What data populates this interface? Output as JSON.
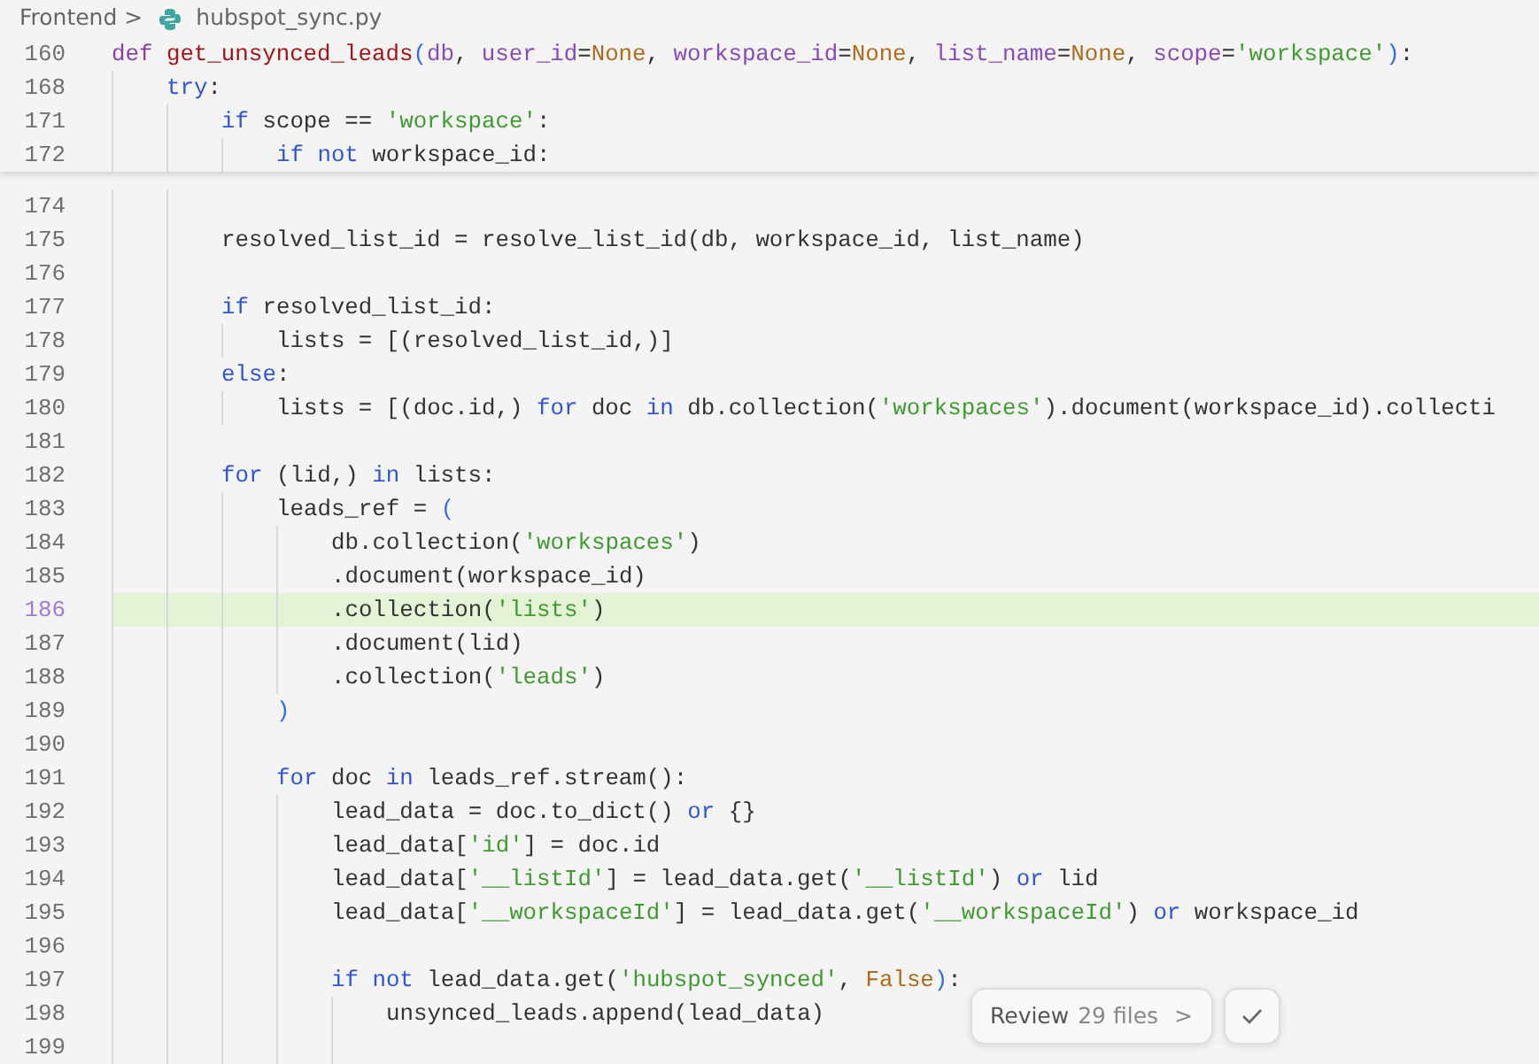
{
  "breadcrumb": {
    "folder": "Frontend",
    "separator": ">",
    "file": "hubspot_sync.py"
  },
  "sticky_lines": [
    {
      "number": "160",
      "tokens": [
        {
          "text": "def ",
          "kind": "def"
        },
        {
          "text": "get_unsynced_leads",
          "kind": "fn"
        },
        {
          "text": "(",
          "kind": "bracket"
        },
        {
          "text": "db",
          "kind": "param"
        },
        {
          "text": ", ",
          "kind": "plain"
        },
        {
          "text": "user_id",
          "kind": "param"
        },
        {
          "text": "=",
          "kind": "plain"
        },
        {
          "text": "None",
          "kind": "const"
        },
        {
          "text": ", ",
          "kind": "plain"
        },
        {
          "text": "workspace_id",
          "kind": "param"
        },
        {
          "text": "=",
          "kind": "plain"
        },
        {
          "text": "None",
          "kind": "const"
        },
        {
          "text": ", ",
          "kind": "plain"
        },
        {
          "text": "list_name",
          "kind": "param"
        },
        {
          "text": "=",
          "kind": "plain"
        },
        {
          "text": "None",
          "kind": "const"
        },
        {
          "text": ", ",
          "kind": "plain"
        },
        {
          "text": "scope",
          "kind": "param"
        },
        {
          "text": "=",
          "kind": "plain"
        },
        {
          "text": "'workspace'",
          "kind": "str"
        },
        {
          "text": ")",
          "kind": "bracket"
        },
        {
          "text": ":",
          "kind": "plain"
        }
      ]
    },
    {
      "number": "168",
      "tokens": [
        {
          "text": "    try",
          "kind": "kw"
        },
        {
          "text": ":",
          "kind": "plain"
        }
      ]
    },
    {
      "number": "171",
      "tokens": [
        {
          "text": "        if",
          "kind": "kw"
        },
        {
          "text": " scope == ",
          "kind": "plain"
        },
        {
          "text": "'workspace'",
          "kind": "str"
        },
        {
          "text": ":",
          "kind": "plain"
        }
      ]
    },
    {
      "number": "172",
      "tokens": [
        {
          "text": "            if not",
          "kind": "kw"
        },
        {
          "text": " workspace_id:",
          "kind": "plain"
        }
      ]
    }
  ],
  "lines": [
    {
      "number": "174",
      "highlighted": false
    },
    {
      "number": "175",
      "highlighted": false,
      "tokens": [
        {
          "text": "        resolved_list_id = resolve_list_id(db, workspace_id, list_name)",
          "kind": "plain"
        }
      ]
    },
    {
      "number": "176",
      "highlighted": false
    },
    {
      "number": "177",
      "highlighted": false,
      "tokens": [
        {
          "text": "        if",
          "kind": "kw"
        },
        {
          "text": " resolved_list_id:",
          "kind": "plain"
        }
      ]
    },
    {
      "number": "178",
      "highlighted": false,
      "tokens": [
        {
          "text": "            lists = [(resolved_list_id,)]",
          "kind": "plain"
        }
      ]
    },
    {
      "number": "179",
      "highlighted": false,
      "tokens": [
        {
          "text": "        else",
          "kind": "kw"
        },
        {
          "text": ":",
          "kind": "plain"
        }
      ]
    },
    {
      "number": "180",
      "highlighted": false,
      "tokens": [
        {
          "text": "            lists = [(doc.id,) ",
          "kind": "plain"
        },
        {
          "text": "for",
          "kind": "kw"
        },
        {
          "text": " doc ",
          "kind": "plain"
        },
        {
          "text": "in",
          "kind": "kw"
        },
        {
          "text": " db.collection(",
          "kind": "plain"
        },
        {
          "text": "'workspaces'",
          "kind": "str"
        },
        {
          "text": ").document(workspace_id).collecti",
          "kind": "plain"
        }
      ]
    },
    {
      "number": "181",
      "highlighted": false
    },
    {
      "number": "182",
      "highlighted": false,
      "tokens": [
        {
          "text": "        for",
          "kind": "kw"
        },
        {
          "text": " (lid,) ",
          "kind": "plain"
        },
        {
          "text": "in",
          "kind": "kw"
        },
        {
          "text": " lists:",
          "kind": "plain"
        }
      ]
    },
    {
      "number": "183",
      "highlighted": false,
      "tokens": [
        {
          "text": "            leads_ref = ",
          "kind": "plain"
        },
        {
          "text": "(",
          "kind": "bracket"
        }
      ]
    },
    {
      "number": "184",
      "highlighted": false,
      "tokens": [
        {
          "text": "                db.collection(",
          "kind": "plain"
        },
        {
          "text": "'workspaces'",
          "kind": "str"
        },
        {
          "text": ")",
          "kind": "plain"
        }
      ]
    },
    {
      "number": "185",
      "highlighted": false,
      "tokens": [
        {
          "text": "                .document(workspace_id)",
          "kind": "plain"
        }
      ]
    },
    {
      "number": "186",
      "highlighted": true,
      "tokens": [
        {
          "text": "                .collection(",
          "kind": "plain"
        },
        {
          "text": "'lists'",
          "kind": "str"
        },
        {
          "text": ")",
          "kind": "plain"
        }
      ]
    },
    {
      "number": "187",
      "highlighted": false,
      "tokens": [
        {
          "text": "                .document(lid)",
          "kind": "plain"
        }
      ]
    },
    {
      "number": "188",
      "highlighted": false,
      "tokens": [
        {
          "text": "                .collection(",
          "kind": "plain"
        },
        {
          "text": "'leads'",
          "kind": "str"
        },
        {
          "text": ")",
          "kind": "plain"
        }
      ]
    },
    {
      "number": "189",
      "highlighted": false,
      "tokens": [
        {
          "text": "            )",
          "kind": "bracket"
        }
      ]
    },
    {
      "number": "190",
      "highlighted": false
    },
    {
      "number": "191",
      "highlighted": false,
      "tokens": [
        {
          "text": "            for",
          "kind": "kw"
        },
        {
          "text": " doc ",
          "kind": "plain"
        },
        {
          "text": "in",
          "kind": "kw"
        },
        {
          "text": " leads_ref.stream():",
          "kind": "plain"
        }
      ]
    },
    {
      "number": "192",
      "highlighted": false,
      "tokens": [
        {
          "text": "                lead_data = doc.to_dict() ",
          "kind": "plain"
        },
        {
          "text": "or",
          "kind": "kw"
        },
        {
          "text": " {}",
          "kind": "plain"
        }
      ]
    },
    {
      "number": "193",
      "highlighted": false,
      "tokens": [
        {
          "text": "                lead_data[",
          "kind": "plain"
        },
        {
          "text": "'id'",
          "kind": "str"
        },
        {
          "text": "] = doc.id",
          "kind": "plain"
        }
      ]
    },
    {
      "number": "194",
      "highlighted": false,
      "tokens": [
        {
          "text": "                lead_data[",
          "kind": "plain"
        },
        {
          "text": "'__listId'",
          "kind": "str"
        },
        {
          "text": "] = lead_data.get(",
          "kind": "plain"
        },
        {
          "text": "'__listId'",
          "kind": "str"
        },
        {
          "text": ") ",
          "kind": "plain"
        },
        {
          "text": "or",
          "kind": "kw"
        },
        {
          "text": " lid",
          "kind": "plain"
        }
      ]
    },
    {
      "number": "195",
      "highlighted": false,
      "tokens": [
        {
          "text": "                lead_data[",
          "kind": "plain"
        },
        {
          "text": "'__workspaceId'",
          "kind": "str"
        },
        {
          "text": "] = lead_data.get(",
          "kind": "plain"
        },
        {
          "text": "'__workspaceId'",
          "kind": "str"
        },
        {
          "text": ") ",
          "kind": "plain"
        },
        {
          "text": "or",
          "kind": "kw"
        },
        {
          "text": " workspace_id",
          "kind": "plain"
        }
      ]
    },
    {
      "number": "196",
      "highlighted": false
    },
    {
      "number": "197",
      "highlighted": false,
      "tokens": [
        {
          "text": "                if not",
          "kind": "kw"
        },
        {
          "text": " lead_data.get(",
          "kind": "plain"
        },
        {
          "text": "'hubspot_synced'",
          "kind": "str"
        },
        {
          "text": ", ",
          "kind": "plain"
        },
        {
          "text": "False",
          "kind": "const"
        },
        {
          "text": ")",
          "kind": "bracket"
        },
        {
          "text": ":",
          "kind": "plain"
        }
      ]
    },
    {
      "number": "198",
      "highlighted": false,
      "tokens": [
        {
          "text": "                    unsynced_leads.append(lead_data)",
          "kind": "plain"
        }
      ]
    },
    {
      "number": "199",
      "highlighted": false
    }
  ],
  "review": {
    "label": "Review",
    "count": "29 files",
    "chevron": ">"
  }
}
